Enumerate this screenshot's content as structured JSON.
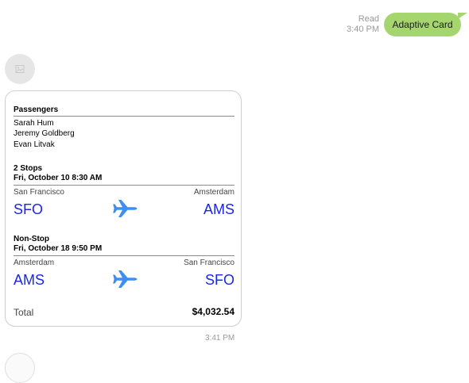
{
  "sent": {
    "status": "Read",
    "time": "3:40 PM",
    "text": "Adaptive Card"
  },
  "card": {
    "passengers_header": "Passengers",
    "passengers": [
      "Sarah Hum",
      "Jeremy Goldberg",
      "Evan Litvak"
    ],
    "flights": [
      {
        "stops": "2 Stops",
        "datetime": "Fri, October 10 8:30 AM",
        "from_city": "San Francisco",
        "to_city": "Amsterdam",
        "from_code": "SFO",
        "to_code": "AMS"
      },
      {
        "stops": "Non-Stop",
        "datetime": "Fri, October 18 9:50 PM",
        "from_city": "Amsterdam",
        "to_city": "San Francisco",
        "from_code": "AMS",
        "to_code": "SFO"
      }
    ],
    "total_label": "Total",
    "total_value": "$4,032.54"
  },
  "received": {
    "time": "3:41 PM"
  },
  "colors": {
    "sent_bubble": "#a5d66e",
    "airport_code": "#1a28e6",
    "plane_icon": "#3d8ef0"
  }
}
